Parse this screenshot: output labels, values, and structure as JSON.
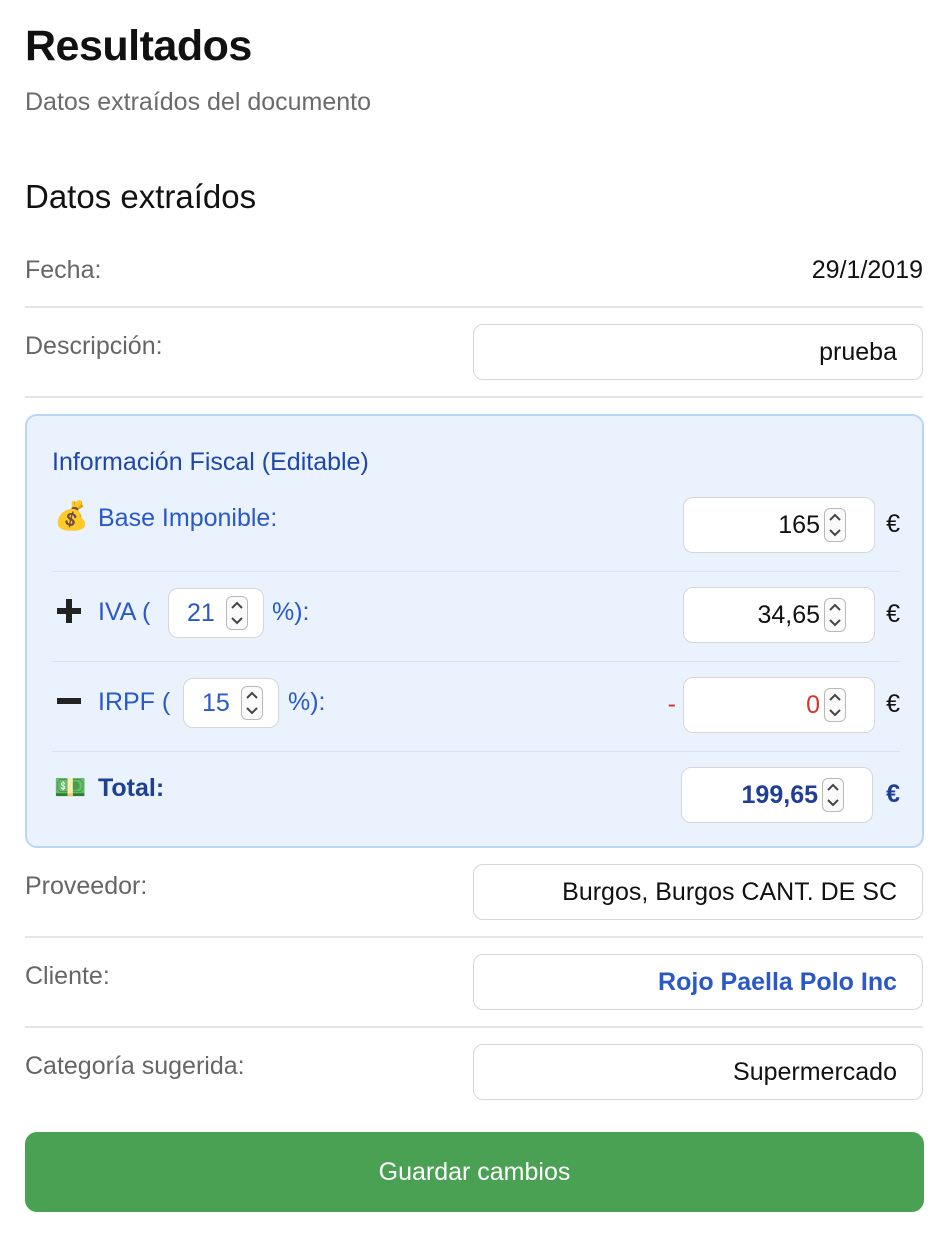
{
  "header": {
    "title": "Resultados",
    "subtitle": "Datos extraídos del documento"
  },
  "section": {
    "title": "Datos extraídos"
  },
  "fields": {
    "fecha": {
      "label": "Fecha:",
      "value": "29/1/2019"
    },
    "descripcion": {
      "label": "Descripción:",
      "value": "prueba"
    },
    "proveedor": {
      "label": "Proveedor:",
      "value": "Burgos, Burgos CANT. DE SC"
    },
    "cliente": {
      "label": "Cliente:",
      "value": "Rojo Paella Polo Inc"
    },
    "categoria": {
      "label": "Categoría sugerida:",
      "value": "Supermercado"
    }
  },
  "fiscal": {
    "title": "Información Fiscal (Editable)",
    "currency": "€",
    "base": {
      "icon": "money-bag-icon",
      "glyph": "💰",
      "label": "Base Imponible:",
      "value": "165"
    },
    "iva": {
      "icon": "plus-icon",
      "glyph": "➕",
      "label_prefix": "IVA (",
      "label_suffix": "%):",
      "rate": "21",
      "value": "34,65"
    },
    "irpf": {
      "icon": "minus-icon",
      "glyph": "➖",
      "label_prefix": "IRPF (",
      "label_suffix": "%):",
      "rate": "15",
      "sign": "-",
      "value": "0"
    },
    "total": {
      "icon": "dollar-banknote-icon",
      "glyph": "💵",
      "label": "Total:",
      "value": "199,65"
    }
  },
  "actions": {
    "save_label": "Guardar cambios"
  },
  "colors": {
    "accent_blue": "#2a58c7",
    "fiscal_bg": "#eaf3fd",
    "save_green": "#4aa154",
    "negative_red": "#d9342b"
  }
}
